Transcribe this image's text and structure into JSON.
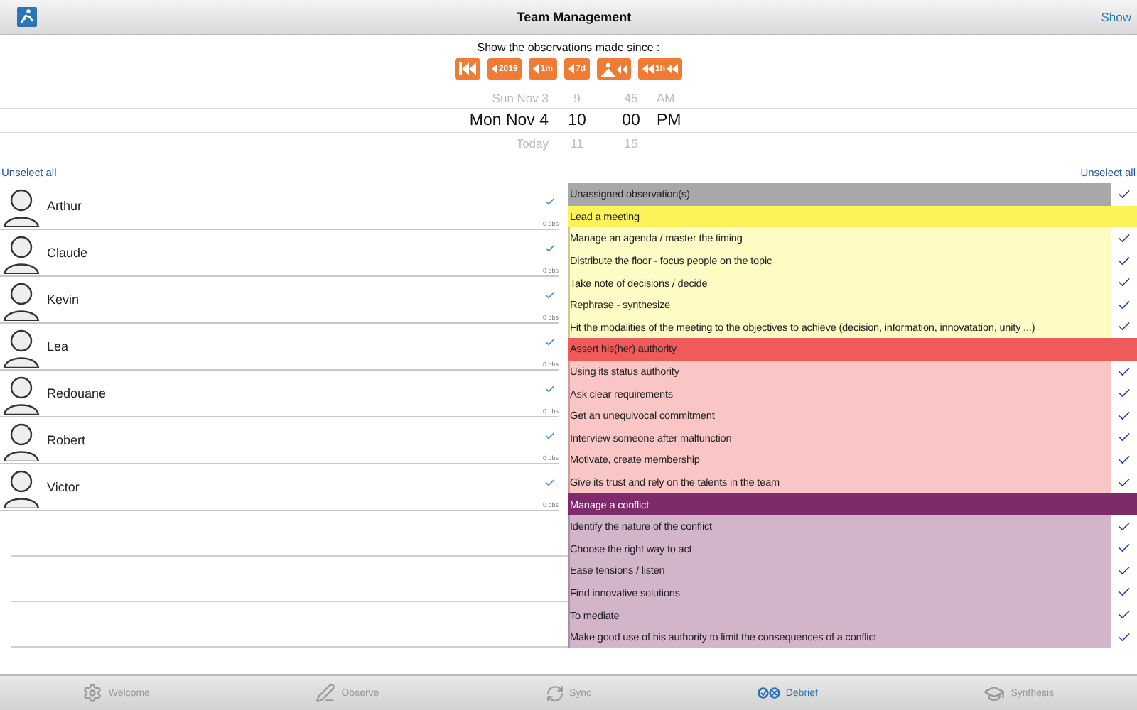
{
  "header": {
    "title": "Team Management",
    "action": "Show"
  },
  "filter": {
    "caption": "Show the observations made since :",
    "buttons": [
      {
        "kind": "start"
      },
      {
        "kind": "back",
        "label": "2019"
      },
      {
        "kind": "back",
        "label": "1m"
      },
      {
        "kind": "back",
        "label": "7d"
      },
      {
        "kind": "session"
      },
      {
        "kind": "rewind",
        "label": "1h"
      }
    ],
    "picker": [
      {
        "above": "Sun Nov 3",
        "value": "Mon Nov 4",
        "below": "Today"
      },
      {
        "above": "9",
        "value": "10",
        "below": "11"
      },
      {
        "above": "45",
        "value": "00",
        "below": "15"
      },
      {
        "above": "AM",
        "value": "PM"
      }
    ]
  },
  "members": {
    "unselect": "Unselect all",
    "items": [
      {
        "name": "Arthur",
        "checked": true,
        "count": "0 obs"
      },
      {
        "name": "Claude",
        "checked": true,
        "count": "0 obs"
      },
      {
        "name": "Kevin",
        "checked": true,
        "count": "0 obs"
      },
      {
        "name": "Lea",
        "checked": true,
        "count": "0 obs"
      },
      {
        "name": "Redouane",
        "checked": true,
        "count": "0 obs"
      },
      {
        "name": "Robert",
        "checked": true,
        "count": "0 obs"
      },
      {
        "name": "Victor",
        "checked": true,
        "count": "0 obs"
      }
    ]
  },
  "skills": {
    "unselect": "Unselect all",
    "groups": [
      {
        "label": "Unassigned observation(s)",
        "color": "#a8a8a8",
        "checked": true
      },
      {
        "label": "Lead a meeting",
        "color": "#fcf35a",
        "items": [
          {
            "label": "Manage an agenda / master the timing",
            "checked": true
          },
          {
            "label": "Distribute the floor - focus people on the topic",
            "checked": true
          },
          {
            "label": "Take note of decisions / decide",
            "checked": true
          },
          {
            "label": "Rephrase - synthesize",
            "checked": true
          },
          {
            "label": "Fit the modalities of the meeting to the objectives to achieve (decision, information, innovatation, unity ...)",
            "checked": true
          }
        ]
      },
      {
        "label": "Assert his(her) authority",
        "color": "#ef5a5a",
        "items": [
          {
            "label": "Using its status authority",
            "checked": true
          },
          {
            "label": "Ask clear requirements",
            "checked": true
          },
          {
            "label": "Get an unequivocal commitment",
            "checked": true
          },
          {
            "label": "Interview someone after malfunction",
            "checked": true
          },
          {
            "label": "Motivate, create membership",
            "checked": true
          },
          {
            "label": "Give its trust and rely on the talents in the team",
            "checked": true
          }
        ]
      },
      {
        "label": "Manage a conflict",
        "color": "#7f2a6a",
        "items": [
          {
            "label": "Identify the nature of the conflict",
            "checked": true
          },
          {
            "label": "Choose the right way to act",
            "checked": true
          },
          {
            "label": "Ease tensions / listen",
            "checked": true
          },
          {
            "label": "Find innovative solutions",
            "checked": true
          },
          {
            "label": "To mediate",
            "checked": true
          },
          {
            "label": "Make good use of his authority to limit the consequences of a conflict",
            "checked": true
          }
        ]
      }
    ]
  },
  "tabs": [
    {
      "kind": "gear",
      "label": "Welcome",
      "selected": false
    },
    {
      "kind": "observe",
      "label": "Observe",
      "selected": false
    },
    {
      "kind": "sync",
      "label": "Sync",
      "selected": false
    },
    {
      "kind": "debrief",
      "label": "Debrief",
      "selected": true
    },
    {
      "kind": "cap",
      "label": "Synthesis",
      "selected": false
    }
  ]
}
